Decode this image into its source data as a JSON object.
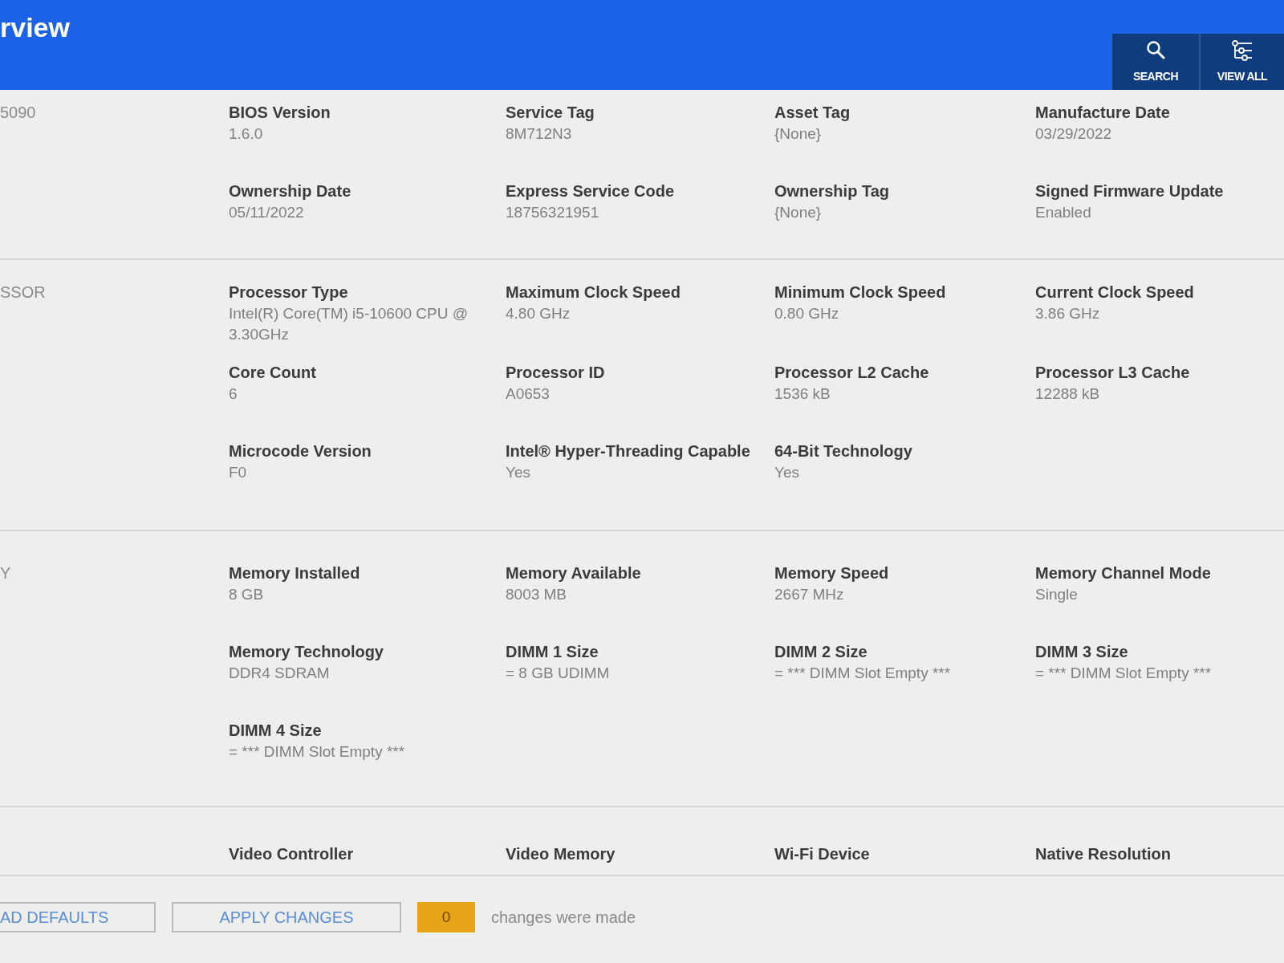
{
  "header": {
    "title": "rview",
    "buttons": [
      {
        "kind": "search",
        "label": "SEARCH"
      },
      {
        "kind": "view_all",
        "label": "VIEW ALL"
      }
    ]
  },
  "sections": [
    {
      "heading": "5090",
      "fields": [
        {
          "label": "BIOS Version",
          "value": "1.6.0"
        },
        {
          "label": "Service Tag",
          "value": "8M712N3"
        },
        {
          "label": "Asset Tag",
          "value": "{None}"
        },
        {
          "label": "Manufacture Date",
          "value": "03/29/2022"
        },
        {
          "label": "Ownership Date",
          "value": "05/11/2022"
        },
        {
          "label": "Express Service Code",
          "value": "18756321951"
        },
        {
          "label": "Ownership Tag",
          "value": "{None}"
        },
        {
          "label": "Signed Firmware Update",
          "value": "Enabled"
        }
      ]
    },
    {
      "heading": "SSOR",
      "fields": [
        {
          "label": "Processor Type",
          "value": "Intel(R) Core(TM) i5-10600 CPU @ 3.30GHz"
        },
        {
          "label": "Maximum Clock Speed",
          "value": "4.80 GHz"
        },
        {
          "label": "Minimum Clock Speed",
          "value": "0.80 GHz"
        },
        {
          "label": "Current Clock Speed",
          "value": "3.86 GHz"
        },
        {
          "label": "Core Count",
          "value": "6"
        },
        {
          "label": "Processor ID",
          "value": "A0653"
        },
        {
          "label": "Processor L2 Cache",
          "value": "1536 kB"
        },
        {
          "label": "Processor L3 Cache",
          "value": "12288 kB"
        },
        {
          "label": "Microcode Version",
          "value": "F0"
        },
        {
          "label": "Intel® Hyper-Threading Capable",
          "value": "Yes"
        },
        {
          "label": "64-Bit Technology",
          "value": "Yes"
        }
      ]
    },
    {
      "heading": "Y",
      "fields": [
        {
          "label": "Memory Installed",
          "value": "8 GB"
        },
        {
          "label": "Memory Available",
          "value": "8003 MB"
        },
        {
          "label": "Memory Speed",
          "value": "2667 MHz"
        },
        {
          "label": "Memory Channel Mode",
          "value": "Single"
        },
        {
          "label": "Memory Technology",
          "value": "DDR4 SDRAM"
        },
        {
          "label": "DIMM 1 Size",
          "value": "= 8 GB UDIMM"
        },
        {
          "label": "DIMM 2 Size",
          "value": "= *** DIMM Slot Empty ***"
        },
        {
          "label": "DIMM 3 Size",
          "value": "= *** DIMM Slot Empty ***"
        },
        {
          "label": "DIMM 4 Size",
          "value": "= *** DIMM Slot Empty ***"
        }
      ]
    },
    {
      "fields": [
        {
          "label": "Video Controller"
        },
        {
          "label": "Video Memory"
        },
        {
          "label": "Wi-Fi Device"
        },
        {
          "label": "Native Resolution"
        }
      ]
    }
  ],
  "footer": {
    "buttons": [
      {
        "kind": "defaults",
        "label": "AD DEFAULTS"
      },
      {
        "kind": "apply",
        "label": "APPLY CHANGES"
      }
    ],
    "change_count": "0",
    "status_text": "changes were made"
  }
}
